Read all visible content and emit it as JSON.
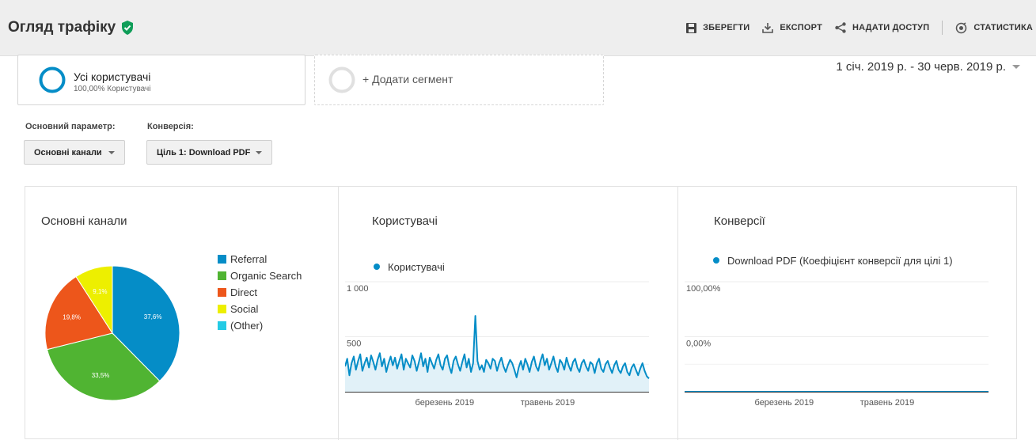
{
  "header": {
    "title": "Огляд трафіку",
    "actions": {
      "save": "ЗБЕРЕГТИ",
      "export": "ЕКСПОРТ",
      "share": "НАДАТИ ДОСТУП",
      "insights": "СТАТИСТИКА"
    }
  },
  "segments": {
    "active": {
      "name": "Усі користувачі",
      "subtitle": "100,00% Користувачі"
    },
    "add_label": "+ Додати сегмент"
  },
  "date_range": "1 січ. 2019 р. - 30 черв. 2019 р.",
  "controls": {
    "primary_dimension_label": "Основний параметр:",
    "primary_dimension_value": "Основні канали",
    "conversion_label": "Конверсія:",
    "conversion_value": "Ціль 1: Download PDF"
  },
  "colors": {
    "accent": "#058dc7",
    "referral": "#058dc7",
    "organic": "#50b432",
    "direct": "#ed561b",
    "social": "#edef00",
    "other": "#24cbe5"
  },
  "icons": [
    "save-icon",
    "download-icon",
    "share-icon",
    "insights-icon",
    "verified-check-icon"
  ],
  "chart_data": [
    {
      "type": "pie",
      "title": "Основні канали",
      "legend_position": "right",
      "slices": [
        {
          "name": "Referral",
          "value": 37.6,
          "label": "37,6%",
          "color": "#058dc7"
        },
        {
          "name": "Organic Search",
          "value": 33.5,
          "label": "33,5%",
          "color": "#50b432"
        },
        {
          "name": "Direct",
          "value": 19.8,
          "label": "19,8%",
          "color": "#ed561b"
        },
        {
          "name": "Social",
          "value": 9.1,
          "label": "9,1%",
          "color": "#edef00"
        },
        {
          "name": "(Other)",
          "value": 0.0,
          "label": "",
          "color": "#24cbe5"
        }
      ]
    },
    {
      "type": "area",
      "title": "Користувачі",
      "x_start": "2019-01-01",
      "x_end": "2019-06-30",
      "x_ticks": [
        "березень 2019",
        "травень 2019"
      ],
      "y_ticks": [
        "1 000",
        "500"
      ],
      "ylim": [
        0,
        1000
      ],
      "series": [
        {
          "name": "Користувачі",
          "color": "#058dc7",
          "values": [
            230,
            300,
            150,
            260,
            320,
            200,
            280,
            340,
            190,
            260,
            310,
            220,
            330,
            270,
            200,
            290,
            350,
            230,
            300,
            180,
            260,
            320,
            240,
            310,
            210,
            280,
            340,
            200,
            300,
            260,
            220,
            330,
            280,
            190,
            270,
            350,
            230,
            300,
            180,
            310,
            260,
            210,
            290,
            340,
            240,
            200,
            300,
            330,
            230,
            170,
            280,
            320,
            250,
            190,
            270,
            340,
            220,
            300,
            180,
            260,
            690,
            280,
            200,
            240,
            180,
            290,
            260,
            210,
            300,
            280,
            190,
            260,
            310,
            230,
            180,
            240,
            290,
            260,
            200,
            130,
            220,
            280,
            200,
            300,
            250,
            180,
            270,
            320,
            230,
            190,
            280,
            340,
            240,
            300,
            200,
            260,
            320,
            230,
            180,
            290,
            260,
            200,
            310,
            240,
            190,
            270,
            300,
            220,
            180,
            260,
            290,
            230,
            190,
            270,
            250,
            170,
            260,
            300,
            210,
            180,
            250,
            280,
            220,
            170,
            240,
            280,
            200,
            170,
            230,
            260,
            180,
            150,
            220,
            250,
            200,
            150,
            210,
            260,
            190,
            140,
            120
          ]
        }
      ]
    },
    {
      "type": "line",
      "title": "Конверсії",
      "x_start": "2019-01-01",
      "x_end": "2019-06-30",
      "x_ticks": [
        "березень 2019",
        "травень 2019"
      ],
      "y_ticks": [
        "100,00%",
        "0,00%"
      ],
      "ylim": [
        0,
        100
      ],
      "series": [
        {
          "name": "Download PDF (Коефіцієнт конверсії для цілі 1)",
          "color": "#058dc7",
          "values": [
            0,
            0,
            0,
            0,
            0,
            0,
            0,
            0,
            0,
            0,
            0,
            0,
            0,
            0,
            0,
            0,
            0,
            0,
            0,
            0,
            0,
            0,
            0,
            0,
            0,
            0,
            0,
            0,
            0,
            0,
            0,
            0,
            0,
            0,
            0,
            0,
            0,
            0,
            0,
            0,
            0,
            0,
            0,
            0,
            0,
            0,
            0,
            0,
            0,
            0,
            0,
            0,
            0,
            0,
            0,
            0,
            0,
            0,
            0,
            0,
            0,
            0,
            0,
            0,
            0,
            0,
            0,
            0,
            0,
            0,
            0,
            0,
            0,
            0,
            0,
            0,
            0,
            0,
            0,
            0,
            0,
            0,
            0,
            0,
            0,
            0,
            0,
            0,
            0,
            0,
            0,
            0,
            0,
            0,
            0,
            0,
            0,
            0,
            0,
            0,
            0,
            0,
            0,
            0,
            0,
            0,
            0,
            0,
            0,
            0,
            0,
            0,
            0,
            0,
            0,
            0,
            0,
            0,
            0,
            0,
            0,
            0,
            0,
            0,
            0,
            0,
            0,
            0,
            0,
            0,
            0,
            0,
            0,
            0,
            0,
            0,
            0,
            0,
            0,
            0
          ]
        }
      ]
    }
  ]
}
